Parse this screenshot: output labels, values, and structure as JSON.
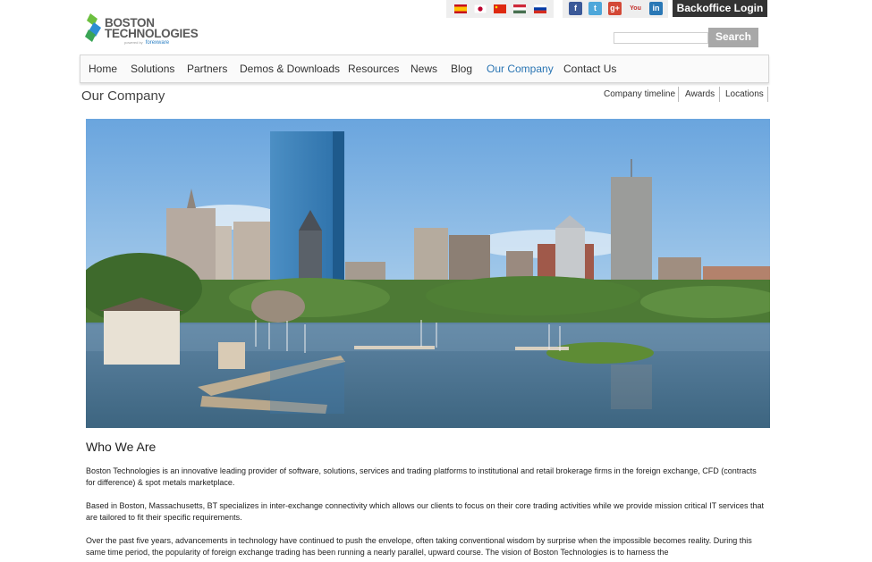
{
  "logo": {
    "line1": "BOSTON",
    "line2": "TECHNOLOGIES",
    "powered": "powered by",
    "brand": "forexware"
  },
  "languages": [
    "spanish-flag-icon",
    "japanese-flag-icon",
    "chinese-flag-icon",
    "hungarian-flag-icon",
    "russian-flag-icon"
  ],
  "social": {
    "facebook": "f",
    "twitter": "t",
    "googleplus": "g+",
    "youtube": "You",
    "linkedin": "in"
  },
  "header": {
    "backoffice_label": "Backoffice Login"
  },
  "search": {
    "placeholder": "",
    "button_label": "Search"
  },
  "nav": {
    "items": [
      {
        "label": "Home"
      },
      {
        "label": "Solutions"
      },
      {
        "label": "Partners"
      },
      {
        "label": "Demos & Downloads"
      },
      {
        "label": "Resources"
      },
      {
        "label": "News"
      },
      {
        "label": "Blog"
      },
      {
        "label": "Our Company",
        "active": true
      },
      {
        "label": "Contact Us"
      }
    ]
  },
  "page": {
    "title": "Our Company",
    "subnav": [
      "Company timeline",
      "Awards",
      "Locations"
    ]
  },
  "content": {
    "heading": "Who We Are",
    "paragraphs": [
      "Boston Technologies is an innovative leading provider of software, solutions, services and trading platforms to institutional and retail brokerage firms in the foreign exchange, CFD (contracts for difference) & spot metals marketplace.",
      "Based in Boston, Massachusetts, BT specializes in inter-exchange connectivity which allows our clients to focus on their core trading activities while we provide mission critical IT services that are tailored to fit their specific requirements.",
      "Over the past five years, advancements in technology have continued to push the envelope, often taking conventional wisdom by surprise when the impossible becomes reality. During this same time period, the popularity of foreign exchange trading has been running a nearly parallel, upward course. The vision of Boston Technologies is to harness the"
    ]
  },
  "colors": {
    "nav_active": "#2a75b3",
    "backoffice_bg": "#333333",
    "search_btn": "#a8a8a8"
  }
}
